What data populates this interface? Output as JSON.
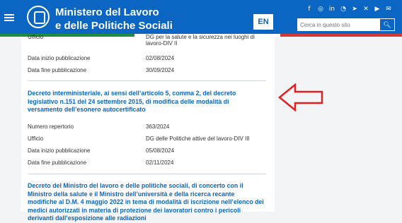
{
  "header": {
    "title_line1": "Ministero del Lavoro",
    "title_line2": "e delle Politiche Sociali",
    "lang_button": "EN",
    "search_placeholder": "Cerca in questo sito",
    "social_icons": [
      "facebook-icon",
      "instagram-icon",
      "linkedin-icon",
      "rss-icon",
      "telegram-icon",
      "x-icon",
      "youtube-icon",
      "mail-icon"
    ],
    "colors": {
      "blue": "#0a66c2",
      "green": "#1e8e3e",
      "red": "#d93636"
    }
  },
  "doc1_tail": {
    "label_ufficio": "Ufficio",
    "ufficio_value": "DG per la salute e la sicurezza nei luoghi di lavoro-DIV II",
    "label_inizio": "Data inizio pubblicazione",
    "inizio": "02/08/2024",
    "label_fine": "Data fine pubblicazione",
    "fine": "30/09/2024"
  },
  "doc2": {
    "title": "Decreto interministeriale, ai sensi dell’articolo 5, comma 2, del decreto legislativo n.151 del 24 settembre 2015, di modifica delle modalità di versamento dell’esonero autocertificato",
    "label_numero": "Numero repertorio",
    "numero": "363/2024",
    "label_ufficio": "Ufficio",
    "ufficio": "DG delle Politiche attive del lavoro-DIV III",
    "label_inizio": "Data inizio pubblicazione",
    "inizio": "05/08/2024",
    "label_fine": "Data fine pubblicazione",
    "fine": "02/11/2024"
  },
  "doc3": {
    "title": "Decreto del Ministro del lavoro e delle politiche sociali, di concerto con il Ministro della salute e il Ministro dell’università e della ricerca recante modifiche al D.M. 4 maggio 2022 in tema di modalità di iscrizione nell’elenco dei medici autorizzati in materia di protezione dei lavoratori contro i pericoli derivanti dall’esposizione alle radiazioni"
  },
  "annotation": {
    "color": "#e02020"
  }
}
